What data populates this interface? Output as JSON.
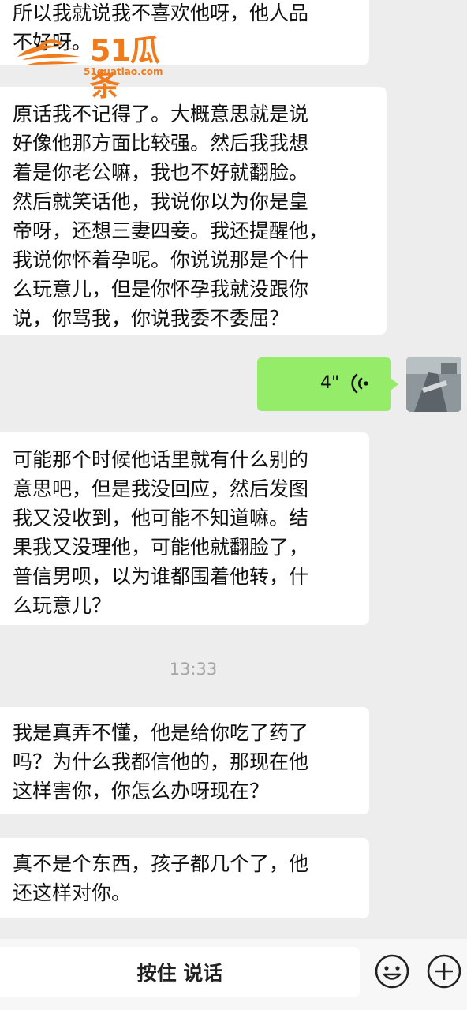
{
  "messages": [
    {
      "text": "所以我就说我不喜欢他呀，他人品\n不好呀。"
    },
    {
      "text": "原话我不记得了。大概意思就是说\n好像他那方面比较强。然后我我想\n着是你老公嘛，我也不好就翻脸。\n然后就笑话他，我说你以为你是皇\n帝呀，还想三妻四妾。我还提醒他，\n我说你怀着孕呢。你说说那是个什\n么玩意儿，但是你怀孕我就没跟你\n说，你骂我，你说我委不委屈？"
    },
    {
      "text": "可能那个时候他话里就有什么别的\n意思吧，但是我没回应，然后发图\n我又没收到，他可能不知道嘛。结\n果我又没理他，可能他就翻脸了，\n普信男呗，以为谁都围着他转，什\n么玩意儿？"
    },
    {
      "text": "我是真弄不懂，他是给你吃了药了\n吗？为什么我都信他的，那现在他\n这样害你，你怎么办呀现在？"
    },
    {
      "text": "真不是个东西，孩子都几个了，他\n还这样对你。"
    }
  ],
  "voice_message": {
    "duration": "4\"",
    "bubble_color": "#95ec69"
  },
  "timestamp": "13:33",
  "watermark": {
    "brand": "51瓜条",
    "url": "51guatiao.com",
    "color": "#f07b1c"
  },
  "toolbar": {
    "hold_to_talk": "按住 说话",
    "emoji_icon": "emoji-icon",
    "plus_icon": "plus-icon"
  }
}
